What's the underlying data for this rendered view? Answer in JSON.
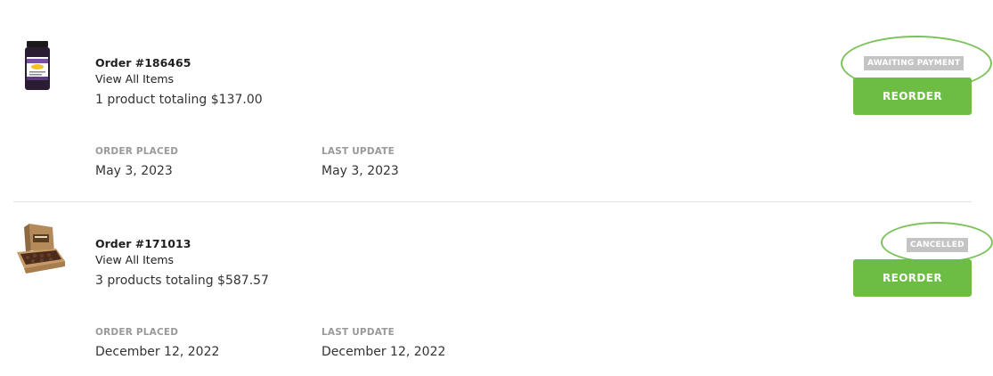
{
  "orders": [
    {
      "title": "Order #186465",
      "view_all_label": "View All Items",
      "summary": "1 product totaling $137.00",
      "placed_label": "ORDER PLACED",
      "placed_value": "May 3, 2023",
      "updated_label": "LAST UPDATE",
      "updated_value": "May 3, 2023",
      "status": "AWAITING PAYMENT",
      "reorder_label": "REORDER",
      "thumbnail_icon": "honey-jar-product-image"
    },
    {
      "title": "Order #171013",
      "view_all_label": "View All Items",
      "summary": "3 products totaling $587.57",
      "placed_label": "ORDER PLACED",
      "placed_value": "December 12, 2022",
      "updated_label": "LAST UPDATE",
      "updated_value": "December 12, 2022",
      "status": "CANCELLED",
      "reorder_label": "REORDER",
      "thumbnail_icon": "open-box-product-image"
    }
  ],
  "colors": {
    "accent_green": "#6dbd45",
    "highlight_ring": "#7cc25b",
    "status_badge_bg": "#c4c4c4",
    "label_gray": "#9a9a9a",
    "divider": "#e3e3e3"
  }
}
